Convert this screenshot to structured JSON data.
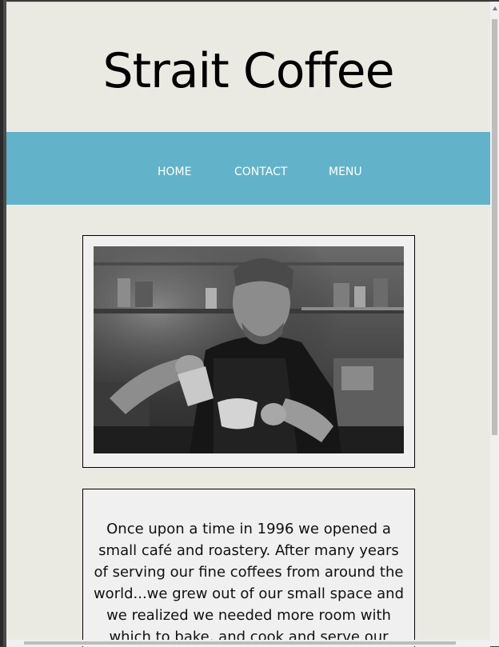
{
  "site": {
    "title": "Strait Coffee"
  },
  "nav": {
    "items": [
      {
        "label": "HOME"
      },
      {
        "label": "CONTACT"
      },
      {
        "label": "MENU"
      }
    ]
  },
  "hero": {
    "alt": "Barista pouring latte art into a cup"
  },
  "story": {
    "text": "Once upon a time in 1996 we opened a small café and roastery. After many years of serving our fine coffees from around the world...we grew out of our small space and we realized we needed more room with which to bake, and cook and serve our"
  },
  "colors": {
    "page_background": "#ebeae2",
    "nav_background": "#62b3c9",
    "card_background": "#f0f0f0",
    "nav_text": "#ffffff"
  }
}
